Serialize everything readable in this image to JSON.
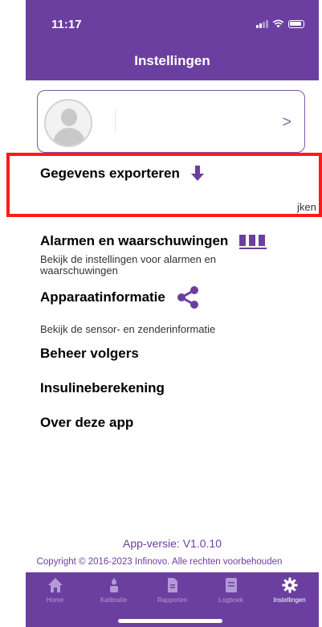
{
  "status_bar": {
    "time": "11:17"
  },
  "header": {
    "title": "Instellingen"
  },
  "profile": {
    "chevron": ">"
  },
  "menu": {
    "export": {
      "title": "Gegevens exporteren",
      "desc_fragment": "jken"
    },
    "alarms": {
      "title": "Alarmen en waarschuwingen",
      "desc": "Bekijk de instellingen voor alarmen en waarschuwingen"
    },
    "device": {
      "title": "Apparaatinformatie",
      "desc": "Bekijk de sensor- en zenderinformatie"
    },
    "followers": {
      "title": "Beheer volgers"
    },
    "insulin": {
      "title": "Insulineberekening"
    },
    "about": {
      "title": "Over deze app"
    }
  },
  "footer": {
    "version": "App-versie: V1.0.10",
    "copyright": "Copyright © 2016-2023 Infinovo. Alle rechten voorbehouden"
  },
  "tabs": [
    {
      "label": "Home",
      "icon": "home-icon"
    },
    {
      "label": "Kalibratie",
      "icon": "finger-drop-icon"
    },
    {
      "label": "Rapporten",
      "icon": "document-icon"
    },
    {
      "label": "Logboek",
      "icon": "logbook-icon"
    },
    {
      "label": "Instellingen",
      "icon": "gear-icon",
      "active": true
    }
  ],
  "colors": {
    "brand": "#6b3fa0",
    "highlight_box": "#ff1a1a"
  }
}
